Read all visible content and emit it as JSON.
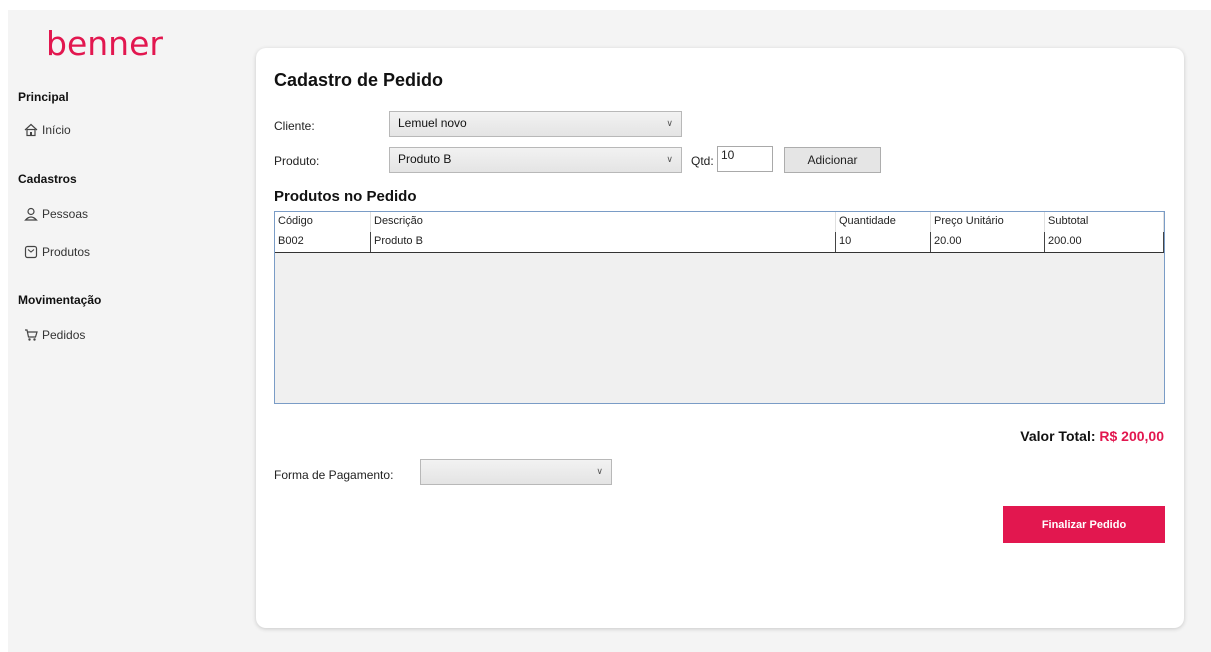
{
  "brand": {
    "logo_text": "benner",
    "accent_color": "#e2174f"
  },
  "sidebar": {
    "sections": [
      {
        "title": "Principal",
        "items": [
          {
            "label": "Início",
            "icon": "home-icon"
          }
        ]
      },
      {
        "title": "Cadastros",
        "items": [
          {
            "label": "Pessoas",
            "icon": "person-icon"
          },
          {
            "label": "Produtos",
            "icon": "product-box-icon"
          }
        ]
      },
      {
        "title": "Movimentação",
        "items": [
          {
            "label": "Pedidos",
            "icon": "cart-icon"
          }
        ]
      }
    ]
  },
  "form": {
    "title": "Cadastro de Pedido",
    "cliente_label": "Cliente:",
    "cliente_value": "Lemuel novo",
    "produto_label": "Produto:",
    "produto_value": "Produto B",
    "qtd_label": "Qtd:",
    "qtd_value": "10",
    "add_button": "Adicionar"
  },
  "products_table": {
    "title": "Produtos no Pedido",
    "columns": [
      "Código",
      "Descrição",
      "Quantidade",
      "Preço Unitário",
      "Subtotal"
    ],
    "rows": [
      [
        "B002",
        "Produto B",
        "10",
        "20.00",
        "200.00"
      ]
    ]
  },
  "total": {
    "label": "Valor Total:",
    "value": "R$ 200,00"
  },
  "payment": {
    "label": "Forma de Pagamento:",
    "value": ""
  },
  "finish_button": "Finalizar Pedido"
}
